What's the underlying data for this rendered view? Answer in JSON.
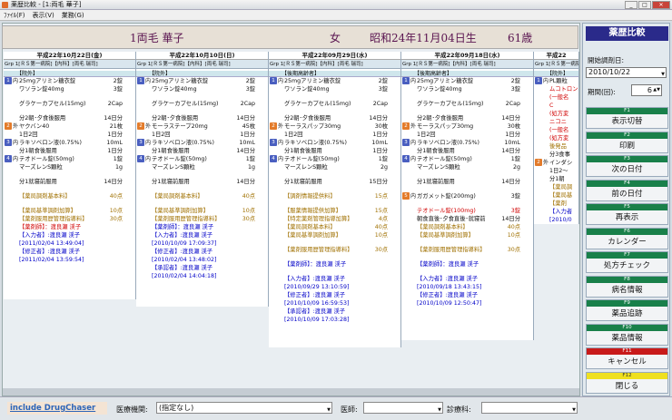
{
  "window": {
    "title": "薬歴比較 - [1:両毛 華子]"
  },
  "menu": [
    "ﾌｧｲﾙ(F)",
    "表示(V)",
    "業務(G)"
  ],
  "patient": {
    "name": "1両毛 華子",
    "sex": "女",
    "dob": "昭和24年11月04日生",
    "age": "61歳"
  },
  "colheader": "Grp 1[ＲＳ第一病院]【内科】[両毛 瑞司]",
  "columns": [
    {
      "date": "平成22年10月22日(金)",
      "bg": "ybg",
      "rows": [
        [
          "gh",
          "",
          "",
          "【院外】",
          ""
        ],
        [
          "rp",
          "1",
          "内",
          "25mgアリミン糖衣錠",
          "2錠"
        ],
        [
          "",
          "",
          "",
          "ワソラン錠40mg",
          "3錠"
        ],
        [
          "sp"
        ],
        [
          "",
          "",
          "",
          "グラケーカプセル(15mg)",
          "2Cap"
        ],
        [
          "sp"
        ],
        [
          "",
          "",
          "",
          "分2朝･夕食後服用",
          "14日分"
        ],
        [
          "rp o",
          "2",
          "外",
          "ヤクバン40",
          "21枚"
        ],
        [
          "",
          "",
          "",
          "1日2回",
          "1日分"
        ],
        [
          "rp",
          "3",
          "内",
          "ラキソベロン液(0.75%)",
          "10mL"
        ],
        [
          "",
          "",
          "",
          "分1朝食後服用",
          "1日分"
        ],
        [
          "rp",
          "4",
          "内",
          "テオドール錠(50mg)",
          "1錠"
        ],
        [
          "",
          "",
          "",
          "マーズレンS顆粒",
          "1g"
        ],
        [
          "sp"
        ],
        [
          "",
          "",
          "",
          "分1就寝前服用",
          "14日分"
        ],
        [
          "sp"
        ],
        [
          "pr",
          "",
          "",
          "【薬局調剤基本料】",
          "40点"
        ],
        [
          "sp"
        ],
        [
          "pr",
          "",
          "",
          "【薬局基準調剤加算】",
          "10点"
        ],
        [
          "pr",
          "",
          "",
          "【薬剤服用歴管理指導料】",
          "30点"
        ],
        [
          "ex",
          "",
          "",
          "【薬剤師】：渡良瀬 渓子",
          ""
        ],
        [
          "ph",
          "",
          "",
          "【入力者】:渡良瀬 渓子",
          ""
        ],
        [
          "ph",
          "",
          "",
          "[2011/02/04 13:49:04]",
          ""
        ],
        [
          "ph",
          "",
          "",
          "【修正者】:渡良瀬 渓子",
          ""
        ],
        [
          "ph",
          "",
          "",
          "[2011/02/04 13:59:54]",
          ""
        ]
      ]
    },
    {
      "date": "平成22年10月10日(日)",
      "bg": "",
      "rows": [
        [
          "gh",
          "",
          "",
          "【院外】",
          ""
        ],
        [
          "rp",
          "1",
          "内",
          "25mgアリミン糖衣錠",
          "2錠"
        ],
        [
          "",
          "",
          "",
          "ワソラン錠40mg",
          "3錠"
        ],
        [
          "sp"
        ],
        [
          "",
          "",
          "",
          "グラケーカプセル(15mg)",
          "2Cap"
        ],
        [
          "sp"
        ],
        [
          "",
          "",
          "",
          "分2朝･夕食後服用",
          "14日分"
        ],
        [
          "rp o",
          "2",
          "外",
          "モーラステープ20mg",
          "45枚"
        ],
        [
          "",
          "",
          "",
          "1日2回",
          "1日分"
        ],
        [
          "rp",
          "3",
          "内",
          "ラキソベロン液(0.75%)",
          "10mL"
        ],
        [
          "",
          "",
          "",
          "分1朝食後服用",
          "14日分"
        ],
        [
          "rp",
          "4",
          "内",
          "テオドール錠(50mg)",
          "1錠"
        ],
        [
          "",
          "",
          "",
          "マーズレンS顆粒",
          "1g"
        ],
        [
          "sp"
        ],
        [
          "",
          "",
          "",
          "分1就寝前服用",
          "14日分"
        ],
        [
          "sp"
        ],
        [
          "pr",
          "",
          "",
          "【薬局調剤基本料】",
          "40点"
        ],
        [
          "sp"
        ],
        [
          "pr",
          "",
          "",
          "【薬局基準調剤加算】",
          "10点"
        ],
        [
          "pr",
          "",
          "",
          "【薬剤服用歴管理指導料】",
          "30点"
        ],
        [
          "ph",
          "",
          "",
          "【薬剤師】：渡良瀬 渓子",
          ""
        ],
        [
          "ph",
          "",
          "",
          "【入力者】:渡良瀬 渓子",
          ""
        ],
        [
          "ph",
          "",
          "",
          "[2010/10/09 17:09:37]",
          ""
        ],
        [
          "ph",
          "",
          "",
          "【修正者】:渡良瀬 渓子",
          ""
        ],
        [
          "ph",
          "",
          "",
          "[2010/02/04 13:48:02]",
          ""
        ],
        [
          "ph",
          "",
          "",
          "【承認者】:渡良瀬 渓子",
          ""
        ],
        [
          "ph",
          "",
          "",
          "[2010/02/04 14:04:18]",
          ""
        ]
      ]
    },
    {
      "date": "平成22年09月29日(水)",
      "bg": "cbg",
      "rows": [
        [
          "gh",
          "",
          "",
          "【後期高齢者】",
          ""
        ],
        [
          "rp",
          "1",
          "内",
          "25mgアリミン糖衣錠",
          "2錠"
        ],
        [
          "",
          "",
          "",
          "ワソラン錠40mg",
          "3錠"
        ],
        [
          "sp"
        ],
        [
          "",
          "",
          "",
          "グラケーカプセル(15mg)",
          "2Cap"
        ],
        [
          "sp"
        ],
        [
          "",
          "",
          "",
          "分2朝･夕食後服用",
          "14日分"
        ],
        [
          "rp o",
          "2",
          "外",
          "モーラスパップ30mg",
          "30枚"
        ],
        [
          "",
          "",
          "",
          "1日2回",
          "1日分"
        ],
        [
          "rp",
          "3",
          "内",
          "ラキソベロン液(0.75%)",
          "10mL"
        ],
        [
          "",
          "",
          "",
          "分1朝食後服用",
          "1日分"
        ],
        [
          "rp",
          "4",
          "内",
          "テオドール錠(50mg)",
          "1錠"
        ],
        [
          "",
          "",
          "",
          "マーズレンS顆粒",
          "2g"
        ],
        [
          "sp"
        ],
        [
          "",
          "",
          "",
          "分1就寝前服用",
          "15日分"
        ],
        [
          "sp"
        ],
        [
          "pr",
          "",
          "",
          "【調剤情報提供料】",
          "15点"
        ],
        [
          "sp"
        ],
        [
          "pr",
          "",
          "",
          "【服薬情報提供加算】",
          "15点"
        ],
        [
          "pr",
          "",
          "",
          "【特定薬剤管理指導加算】",
          "4点"
        ],
        [
          "pr",
          "",
          "",
          "【薬局調剤基本料】",
          "40点"
        ],
        [
          "pr",
          "",
          "",
          "【薬局基準調剤加算】",
          "10点"
        ],
        [
          "sp"
        ],
        [
          "pr",
          "",
          "",
          "【薬剤服用歴管理指導料】",
          "30点"
        ],
        [
          "sp"
        ],
        [
          "ph",
          "",
          "",
          "【薬剤師】：渡良瀬 渓子",
          ""
        ],
        [
          "sp"
        ],
        [
          "ph",
          "",
          "",
          "【入力者】:渡良瀬 渓子",
          ""
        ],
        [
          "ph",
          "",
          "",
          "[2010/09/29 13:10:59]",
          ""
        ],
        [
          "ph",
          "",
          "",
          "【修正者】:渡良瀬 渓子",
          ""
        ],
        [
          "ph",
          "",
          "",
          "[2010/10/09 16:59:53]",
          ""
        ],
        [
          "ph",
          "",
          "",
          "【承認者】:渡良瀬 渓子",
          ""
        ],
        [
          "ph",
          "",
          "",
          "[2010/10/09 17:03:28]",
          ""
        ]
      ]
    },
    {
      "date": "平成22年09月18日(水)",
      "bg": "cbg",
      "rows": [
        [
          "gh",
          "",
          "",
          "【後期高齢者】",
          ""
        ],
        [
          "rp",
          "1",
          "内",
          "25mgアリミン糖衣錠",
          "2錠"
        ],
        [
          "",
          "",
          "",
          "ワソラン錠40mg",
          "3錠"
        ],
        [
          "sp"
        ],
        [
          "",
          "",
          "",
          "グラケーカプセル(15mg)",
          "2Cap"
        ],
        [
          "sp"
        ],
        [
          "",
          "",
          "",
          "分2朝･夕食後服用",
          "14日分"
        ],
        [
          "rp o",
          "2",
          "外",
          "モーラスパップ30mg",
          "30枚"
        ],
        [
          "",
          "",
          "",
          "1日2回",
          "1日分"
        ],
        [
          "rp",
          "3",
          "内",
          "ラキソベロン液(0.75%)",
          "10mL"
        ],
        [
          "",
          "",
          "",
          "分1朝食後服用",
          "14日分"
        ],
        [
          "rp",
          "4",
          "内",
          "テオドール錠(50mg)",
          "1錠"
        ],
        [
          "",
          "",
          "",
          "マーズレンS顆粒",
          "2g"
        ],
        [
          "sp"
        ],
        [
          "",
          "",
          "",
          "分1就寝前服用",
          "14日分"
        ],
        [
          "sp"
        ],
        [
          "rp o",
          "5",
          "内",
          "ガガメット錠(200mg)",
          "3錠"
        ],
        [
          "sp"
        ],
        [
          "ex",
          "",
          "",
          "テオドール錠(100mg)",
          "3錠"
        ],
        [
          "",
          "",
          "",
          "朝食直後･夕食直後･就寝前",
          "14日分"
        ],
        [
          "pr",
          "",
          "",
          "【薬局調剤基本料】",
          "40点"
        ],
        [
          "pr",
          "",
          "",
          "【薬局基準調剤加算】",
          "10点"
        ],
        [
          "sp"
        ],
        [
          "pr",
          "",
          "",
          "【薬剤服用歴管理指導料】",
          "30点"
        ],
        [
          "sp"
        ],
        [
          "ph",
          "",
          "",
          "【薬剤師】：渡良瀬 渓子",
          ""
        ],
        [
          "sp"
        ],
        [
          "ph",
          "",
          "",
          "【入力者】:渡良瀬 渓子",
          ""
        ],
        [
          "ph",
          "",
          "",
          "[2010/09/18 13:43:15]",
          ""
        ],
        [
          "ph",
          "",
          "",
          "【修正者】:渡良瀬 渓子",
          ""
        ],
        [
          "ph",
          "",
          "",
          "[2010/10/09 12:50:47]",
          ""
        ]
      ]
    },
    {
      "date": "平成22",
      "bg": "",
      "rows": [
        [
          "gh",
          "",
          "",
          "【院外】",
          ""
        ],
        [
          "rp",
          "1",
          "内",
          "PL顆粒",
          ""
        ],
        [
          "ex",
          "",
          "",
          "ムコトロン",
          ""
        ],
        [
          "ex",
          "",
          "",
          "(一般名",
          ""
        ],
        [
          "ex",
          "",
          "",
          "C",
          ""
        ],
        [
          "ex",
          "",
          "",
          "(処方変",
          ""
        ],
        [
          "ex",
          "",
          "",
          "ニコニ",
          ""
        ],
        [
          "ex",
          "",
          "",
          "(一般名",
          ""
        ],
        [
          "ex",
          "",
          "",
          "(処方変",
          ""
        ],
        [
          "pr",
          "",
          "",
          "後発品",
          ""
        ],
        [
          "",
          "",
          "",
          "分3食事",
          ""
        ],
        [
          "rp o",
          "2",
          "外",
          "インダシ",
          ""
        ],
        [
          "",
          "",
          "",
          "1日2～",
          ""
        ],
        [
          "",
          "",
          "",
          "分1朝",
          ""
        ],
        [
          "pr",
          "",
          "",
          "【薬局調",
          ""
        ],
        [
          "pr",
          "",
          "",
          "【薬局基",
          ""
        ],
        [
          "pr",
          "",
          "",
          "【薬剤",
          ""
        ],
        [
          "ph",
          "",
          "",
          "【入力者",
          ""
        ],
        [
          "ph",
          "",
          "",
          "[2010/0",
          ""
        ]
      ]
    }
  ],
  "sidebar": {
    "title": "薬歴比較",
    "start_label": "開始調剤日:",
    "start_date": "2010/10/22",
    "period_label": "期間(回):",
    "period_value": "6",
    "buttons": [
      {
        "key": "F1",
        "label": "表示切替"
      },
      {
        "key": "F2",
        "label": "印刷"
      },
      {
        "key": "F3",
        "label": "次の日付"
      },
      {
        "key": "F4",
        "label": "前の日付"
      },
      {
        "key": "F5",
        "label": "再表示"
      },
      {
        "key": "F6",
        "label": "カレンダー"
      },
      {
        "key": "F7",
        "label": "処方チェック"
      },
      {
        "key": "F8",
        "label": "病名情報"
      },
      {
        "key": "F9",
        "label": "薬品追跡"
      },
      {
        "key": "F10",
        "label": "薬品情報"
      },
      {
        "key": "F11",
        "label": "キャンセル"
      },
      {
        "key": "F12",
        "label": "閉じる"
      }
    ]
  },
  "bottom": {
    "link": "include DrugChaser",
    "hospital_label": "医療機関:",
    "hospital_value": "(指定なし)",
    "doctor_label": "医師:",
    "dept_label": "診療科:"
  }
}
